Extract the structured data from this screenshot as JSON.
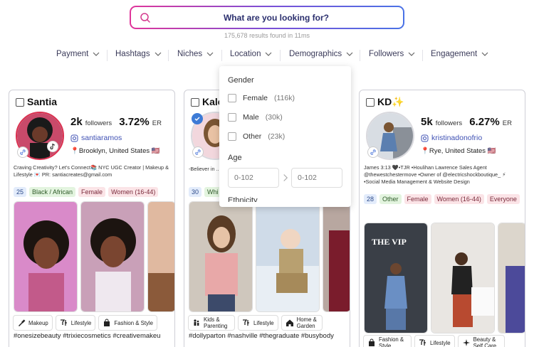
{
  "search": {
    "placeholder": "What are you looking for?",
    "results": "175,678 results found in 11ms"
  },
  "filters": [
    {
      "label": "Payment"
    },
    {
      "label": "Hashtags"
    },
    {
      "label": "Niches"
    },
    {
      "label": "Location"
    },
    {
      "label": "Demographics"
    },
    {
      "label": "Followers"
    },
    {
      "label": "Engagement"
    }
  ],
  "dropdown": {
    "gender_title": "Gender",
    "options": [
      {
        "label": "Female",
        "count": "(116k)"
      },
      {
        "label": "Male",
        "count": "(30k)"
      },
      {
        "label": "Other",
        "count": "(23k)"
      }
    ],
    "age_title": "Age",
    "age_min": "0-102",
    "age_max": "0-102",
    "partial_label": "Ethnicity"
  },
  "cards": [
    {
      "name": "Santia",
      "followers": "2k",
      "followers_label": "followers",
      "er": "3.72%",
      "er_label": "ER",
      "handle": "santiaramos",
      "location": "📍Brooklyn, United States 🇺🇸",
      "bio": "Craving Creativity? Let's Connect📚 NYC UGC Creator | Makeup & Lifestyle 💌 PR: santiacreates@gmail.com",
      "tags": [
        "25",
        "Black / African",
        "Female",
        "Women (16-44)"
      ],
      "categories": [
        "Makeup",
        "Lifestyle",
        "Fashion & Style"
      ],
      "hashtags": "#onesizebeauty #trixiecosmetics #creativemakeu"
    },
    {
      "name": "Kale",
      "bio": "-Believer in ... Teacher -Co...",
      "tags": [
        "30",
        "Whi"
      ],
      "categories": [
        "Kids & Parenting",
        "Lifestyle",
        "Home & Garden"
      ],
      "hashtags": "#dollyparton #nashville #thegraduate #busybody"
    },
    {
      "name": "KD✨",
      "followers": "5k",
      "followers_label": "followers",
      "er": "6.27%",
      "er_label": "ER",
      "handle": "kristinadonofrio",
      "location": "📍Rye, United States 🇺🇸",
      "bio": "James 3:13 🖤•TJR •Houlihan Lawrence Sales Agent @thewestchestermove •Owner of @electricshockboutique_ ⚡ •Social Media Management & Website Design",
      "tags": [
        "28",
        "Other",
        "Female",
        "Women (16-44)",
        "Everyone"
      ],
      "categories": [
        "Fashion & Style",
        "Lifestyle",
        "Beauty & Self Care"
      ],
      "hashtags": ""
    }
  ]
}
